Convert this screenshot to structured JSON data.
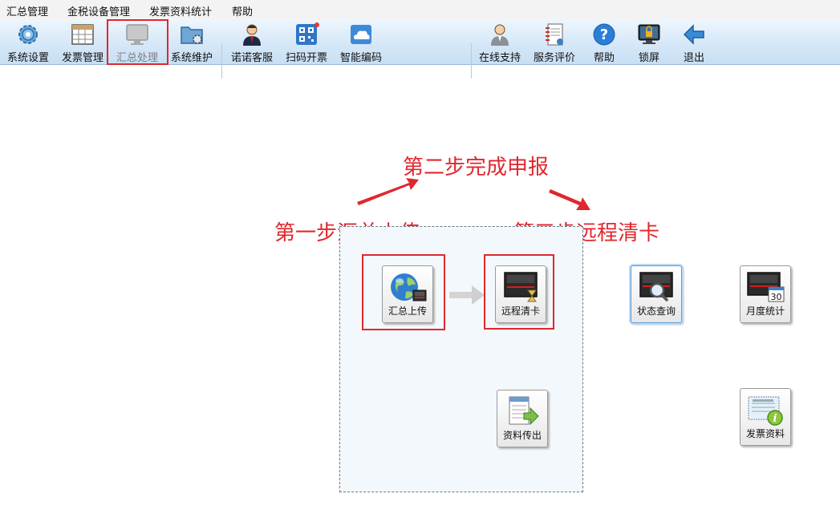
{
  "menu": [
    "汇总管理",
    "金税设备管理",
    "发票资料统计",
    "帮助"
  ],
  "toolbar": {
    "items": [
      {
        "label": "系统设置",
        "icon": "gear-icon"
      },
      {
        "label": "发票管理",
        "icon": "calendar-grid-icon"
      },
      {
        "label": "汇总处理",
        "icon": "monitor-icon",
        "state": "disabled"
      },
      {
        "label": "系统维护",
        "icon": "folder-gear-icon"
      },
      {
        "label": "诺诺客服",
        "icon": "customer-service-icon"
      },
      {
        "label": "扫码开票",
        "icon": "qr-code-icon"
      },
      {
        "label": "智能编码",
        "icon": "cloud-icon"
      },
      {
        "label": "在线支持",
        "icon": "online-support-icon"
      },
      {
        "label": "服务评价",
        "icon": "notebook-icon"
      },
      {
        "label": "帮助",
        "icon": "help-icon"
      },
      {
        "label": "锁屏",
        "icon": "lock-screen-icon"
      },
      {
        "label": "退出",
        "icon": "exit-arrow-icon"
      }
    ]
  },
  "annotations": {
    "step1": "第一步汇总上传",
    "step2": "第二步完成申报",
    "step3": "第三步远程清卡"
  },
  "functions": {
    "upload": "汇总上传",
    "clear": "远程清卡",
    "export": "资料传出",
    "status": "状态查询",
    "monthly": "月度统计",
    "invoice": "发票资料"
  },
  "monthly_calendar_day": "30",
  "colors": {
    "annotation": "#e0272e",
    "accent": "#4a90d9"
  }
}
